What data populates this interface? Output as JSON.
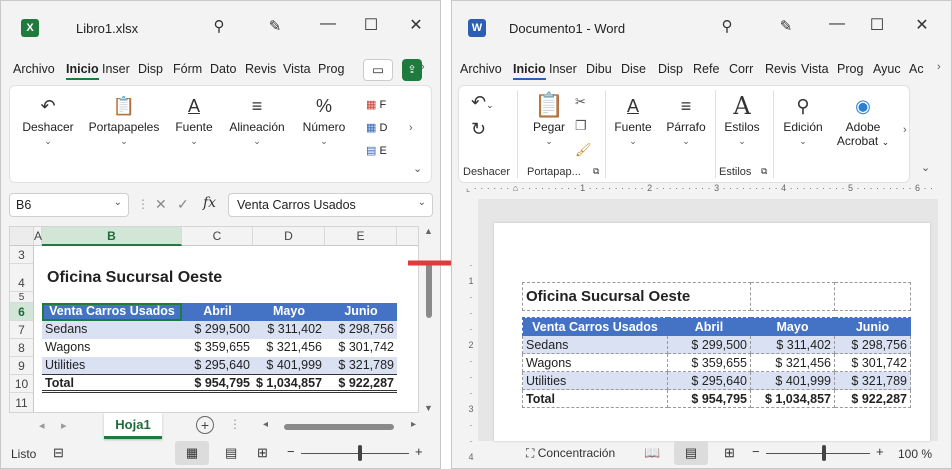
{
  "excel": {
    "title": "Libro1.xlsx",
    "tabs": [
      "Archivo",
      "Inicio",
      "Inser",
      "Disp",
      "Fórm",
      "Dato",
      "Revis",
      "Vista",
      "Prog"
    ],
    "active_tab": "Inicio",
    "ribbon_groups": [
      "Deshacer",
      "Portapapeles",
      "Fuente",
      "Alineación",
      "Número"
    ],
    "style_items": [
      "F",
      "D",
      "E"
    ],
    "name_box": "B6",
    "fx": "fx",
    "formula_value": "Venta Carros Usados",
    "columns": [
      "A",
      "B",
      "C",
      "D",
      "E"
    ],
    "rows": [
      "3",
      "4",
      "5",
      "6",
      "7",
      "8",
      "9",
      "10",
      "11"
    ],
    "sheet_title": "Oficina Sucursal Oeste",
    "header": [
      "Venta Carros Usados",
      "Abril",
      "Mayo",
      "Junio"
    ],
    "data": [
      [
        "Sedans",
        "$ 299,500",
        "$ 311,402",
        "$ 298,756"
      ],
      [
        "Wagons",
        "$ 359,655",
        "$ 321,456",
        "$ 301,742"
      ],
      [
        "Utilities",
        "$ 295,640",
        "$ 401,999",
        "$ 321,789"
      ]
    ],
    "total": [
      "Total",
      "$ 954,795",
      "$ 1,034,857",
      "$ 922,287"
    ],
    "sheet_tab": "Hoja1",
    "status": "Listo"
  },
  "word": {
    "title": "Documento1  -  Word",
    "tabs": [
      "Archivo",
      "Inicio",
      "Inser",
      "Dibu",
      "Dise",
      "Disp",
      "Refe",
      "Corr",
      "Revis",
      "Vista",
      "Prog",
      "Ayuc",
      "Ac"
    ],
    "active_tab": "Inicio",
    "ribbon_groups": [
      "Pegar",
      "Fuente",
      "Párrafo",
      "Estilos",
      "Edición",
      "Adobe",
      "Acrobat"
    ],
    "group_labels": [
      "Deshacer",
      "Portapap...",
      "Estilos"
    ],
    "table_title": "Oficina Sucursal Oeste",
    "header": [
      "Venta Carros Usados",
      "Abril",
      "Mayo",
      "Junio"
    ],
    "data": [
      [
        "Sedans",
        "$ 299,500",
        "$ 311,402",
        "$ 298,756"
      ],
      [
        "Wagons",
        "$ 359,655",
        "$ 321,456",
        "$ 301,742"
      ],
      [
        "Utilities",
        "$ 295,640",
        "$ 401,999",
        "$ 321,789"
      ]
    ],
    "total": [
      "Total",
      "$ 954,795",
      "$ 1,034,857",
      "$ 922,287"
    ],
    "status_focus": "Concentración",
    "zoom": "100 %"
  },
  "colors": {
    "excel_accent": "#1f7a3e",
    "word_accent": "#2b5fb4",
    "table_header": "#4472c4",
    "table_band": "#d9e1f2",
    "arrow": "#e03a3a"
  }
}
